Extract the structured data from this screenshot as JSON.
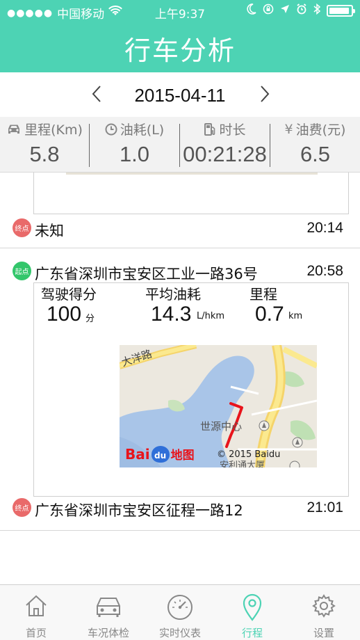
{
  "status_bar": {
    "carrier": "中国移动",
    "time": "上午9:37"
  },
  "header": {
    "title": "行车分析"
  },
  "date_nav": {
    "date": "2015-04-11"
  },
  "summary": [
    {
      "icon": "car-icon",
      "label": "里程(Km)",
      "value": "5.8"
    },
    {
      "icon": "clock-icon",
      "label": "油耗(L)",
      "value": "1.0"
    },
    {
      "icon": "fuel-pump-icon",
      "label": "时长",
      "value": "00:21:28"
    },
    {
      "icon": "yen-icon",
      "label": "油费(元)",
      "value": "6.5"
    }
  ],
  "trips": [
    {
      "end": {
        "badge": "终点",
        "address": "未知",
        "time": "20:14"
      }
    },
    {
      "start": {
        "badge": "起点",
        "address": "广东省深圳市宝安区工业一路36号",
        "time": "20:58"
      },
      "metrics": [
        {
          "label": "驾驶得分",
          "value": "100",
          "unit": "分"
        },
        {
          "label": "平均油耗",
          "value": "14.3",
          "unit": "L/hkm"
        },
        {
          "label": "里程",
          "value": "0.7",
          "unit": "km"
        }
      ],
      "map": {
        "road_label": "大洋路",
        "poi_label": "世源中心",
        "poi2_label": "安利通大厦",
        "copyright": "© 2015 Baidu",
        "logo_text": "Bai",
        "logo_du": "du",
        "logo_map": "地图"
      },
      "end": {
        "badge": "终点",
        "address": "广东省深圳市宝安区征程一路12",
        "time": "21:01"
      }
    }
  ],
  "tabs": [
    {
      "icon": "home-icon",
      "label": "首页",
      "active": false
    },
    {
      "icon": "car-check-icon",
      "label": "车况体检",
      "active": false
    },
    {
      "icon": "speedometer-icon",
      "label": "实时仪表",
      "active": false
    },
    {
      "icon": "location-pin-icon",
      "label": "行程",
      "active": true
    },
    {
      "icon": "settings-gear-icon",
      "label": "设置",
      "active": false
    }
  ],
  "colors": {
    "accent": "#4dd3b4",
    "start_badge": "#33c66b",
    "end_badge": "#e96a6a",
    "route": "#e8141b"
  }
}
